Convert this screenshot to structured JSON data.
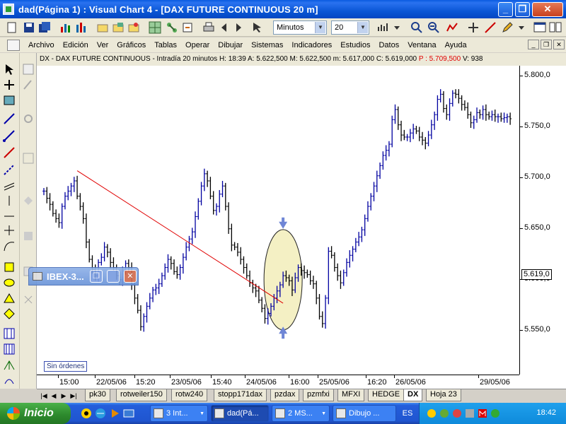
{
  "window": {
    "title": "dad(Página 1) : Visual Chart 4 - [DAX FUTURE CONTINUOUS 20 m]",
    "minimize_glyph": "_",
    "restore_glyph": "❐",
    "close_glyph": "✕"
  },
  "toolbar": {
    "period_unit": "Minutos",
    "period_value": "20",
    "arrow_glyph": "▼"
  },
  "menubar": {
    "items": [
      "Archivo",
      "Edición",
      "Ver",
      "Gráficos",
      "Tablas",
      "Operar",
      "Dibujar",
      "Sistemas",
      "Indicadores",
      "Estudios",
      "Datos",
      "Ventana",
      "Ayuda"
    ],
    "mdi_minimize": "_",
    "mdi_restore": "❐",
    "mdi_close": "✕"
  },
  "chart": {
    "header_prefix": "DX - DAX FUTURE CONTINUOUS - Intradía 20 minutos",
    "header_h": "H: 18:39",
    "header_a": "A: 5.622,500",
    "header_m": "M: 5.622,500",
    "header_mi": "m: 5.617,000",
    "header_c": "C: 5.619,000",
    "header_p": "P : 5.709,500",
    "header_v": "V: 938",
    "header_pp": "P",
    "last_price": "5.619,0",
    "y_ticks": [
      "5.800,0",
      "5.750,0",
      "5.700,0",
      "5.650,0",
      "5.600,0",
      "5.550,0"
    ],
    "x_ticks": [
      "15:00",
      "22/05/06",
      "15:20",
      "23/05/06",
      "15:40",
      "24/05/06",
      "16:00",
      "25/05/06",
      "16:20",
      "26/05/06",
      "29/05/06"
    ],
    "orders_label": "Sin órdenes"
  },
  "chart_data": {
    "type": "candlestick",
    "ylim": [
      5515,
      5818
    ],
    "y_ticks": [
      5800,
      5750,
      5700,
      5650,
      5600,
      5550
    ],
    "close": [
      5695,
      5688,
      5682,
      5673,
      5668,
      5664,
      5680,
      5690,
      5695,
      5700,
      5705,
      5690,
      5680,
      5668,
      5645,
      5628,
      5618,
      5612,
      5625,
      5630,
      5640,
      5635,
      5625,
      5620,
      5612,
      5608,
      5616,
      5624,
      5620,
      5603,
      5590,
      5578,
      5562,
      5572,
      5582,
      5590,
      5598,
      5600,
      5604,
      5612,
      5620,
      5628,
      5624,
      5616,
      5613,
      5620,
      5630,
      5640,
      5648,
      5655,
      5670,
      5685,
      5700,
      5712,
      5705,
      5690,
      5676,
      5680,
      5692,
      5700,
      5680,
      5658,
      5642,
      5640,
      5635,
      5628,
      5620,
      5612,
      5605,
      5600,
      5597,
      5588,
      5580,
      5570,
      5575,
      5582,
      5590,
      5597,
      5603,
      5612,
      5610,
      5607,
      5598,
      5610,
      5620,
      5617,
      5615,
      5613,
      5607,
      5604,
      5590,
      5572,
      5565,
      5590,
      5636,
      5632,
      5620,
      5612,
      5605,
      5615,
      5625,
      5632,
      5638,
      5645,
      5650,
      5657,
      5668,
      5680,
      5690,
      5700,
      5710,
      5720,
      5730,
      5735,
      5741,
      5765,
      5775,
      5760,
      5750,
      5748,
      5748,
      5752,
      5756,
      5754,
      5748,
      5745,
      5742,
      5750,
      5760,
      5770,
      5785,
      5790,
      5776,
      5770,
      5781,
      5791,
      5790,
      5786,
      5780,
      5777,
      5770,
      5762,
      5765,
      5772,
      5770,
      5775,
      5770,
      5768,
      5770,
      5768,
      5768,
      5766,
      5767,
      5768,
      5766
    ],
    "up_color": "#0000a0",
    "down_color": "#000000",
    "trendline": {
      "from": [
        11,
        5715
      ],
      "to": [
        79,
        5585
      ],
      "color": "#e00000"
    },
    "highlight_ellipse_center": [
      79,
      5608
    ],
    "arrow_down_at": [
      79,
      5658
    ],
    "arrow_up_at": [
      79,
      5555
    ]
  },
  "floating_window": {
    "title": "IBEX-3..."
  },
  "sheet_tabs": [
    "pk30",
    "rotweiler150",
    "rotw240",
    "stopp171dax",
    "pzdax",
    "pzmfxi",
    "MFXI",
    "HEDGE",
    "DX",
    "Hoja 23"
  ],
  "active_sheet": "DX",
  "taskbar": {
    "start_label": "Inicio",
    "tasks": [
      {
        "label": "3 Int...",
        "count": "3"
      },
      {
        "label": "dad(Pá..."
      },
      {
        "label": "2 MS..."
      },
      {
        "label": "Dibujo ..."
      }
    ],
    "language": "ES",
    "clock": "18:42"
  },
  "colors": {
    "titlebar_blue": "#0b57d6",
    "trend_red": "#e00000",
    "candle_blue": "#0000a0",
    "ellipse_fill": "#f4f0c4"
  }
}
